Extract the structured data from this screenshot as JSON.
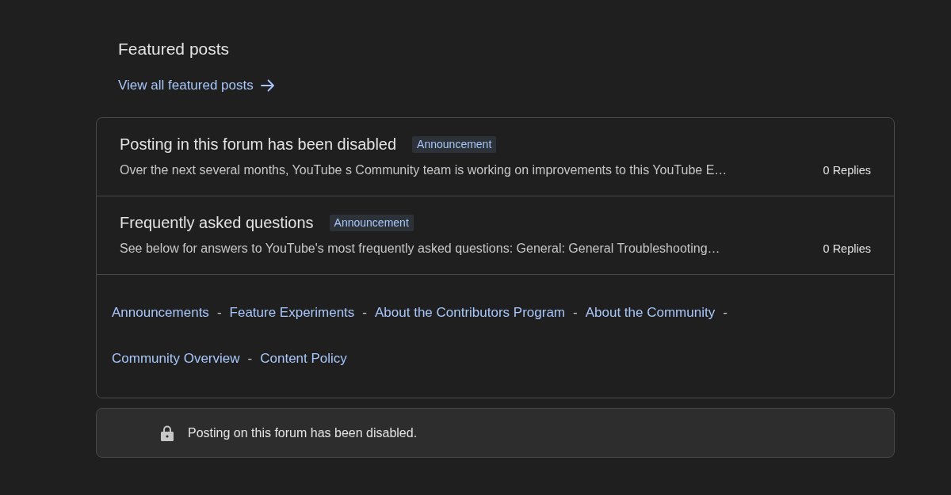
{
  "section": {
    "title": "Featured posts",
    "view_all_link": "View all featured posts"
  },
  "posts": [
    {
      "title": "Posting in this forum has been disabled",
      "tag": "Announcement",
      "snippet": "Over the next several months, YouTube s Community team is working on improvements to this YouTube E…",
      "replies": "0 Replies"
    },
    {
      "title": "Frequently asked questions",
      "tag": "Announcement",
      "snippet": "See below for answers to YouTube's most frequently asked questions: General: General Troubleshooting…",
      "replies": "0 Replies"
    }
  ],
  "footer_link_rows": [
    {
      "links": [
        {
          "label": "Announcements",
          "separator": "-"
        },
        {
          "label": "Feature Experiments",
          "separator": "-"
        },
        {
          "label": "About the Contributors Program",
          "separator": "-"
        },
        {
          "label": "About the Community",
          "separator": "-"
        }
      ]
    },
    {
      "links": [
        {
          "label": "Community Overview",
          "separator": "-"
        },
        {
          "label": "Content Policy"
        }
      ]
    }
  ],
  "notice": {
    "text": "Posting on this forum has been disabled."
  }
}
